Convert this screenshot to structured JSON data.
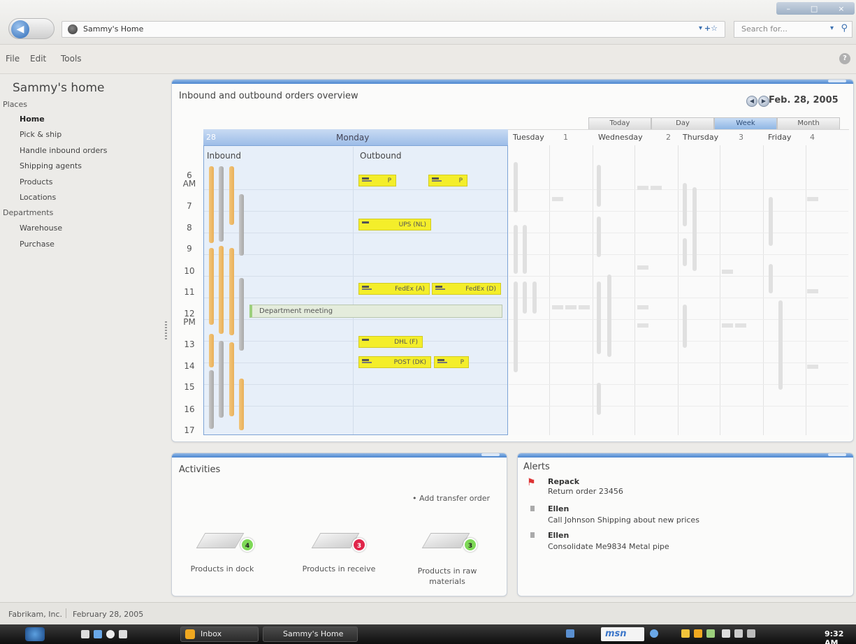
{
  "window": {
    "controls": [
      "–",
      "□",
      "×"
    ]
  },
  "address": {
    "page_title": "Sammy's Home",
    "dropdown": "▾",
    "favorites": "+☆",
    "search_placeholder": "Search for..."
  },
  "menu": {
    "items": [
      "File",
      "Edit",
      "Tools"
    ],
    "help": "?"
  },
  "sidebar": {
    "title": "Sammy's home",
    "places_label": "Places",
    "places": [
      "Home",
      "Pick & ship",
      "Handle inbound orders",
      "Shipping agents",
      "Products",
      "Locations"
    ],
    "departments_label": "Departments",
    "departments": [
      "Warehouse",
      "Purchase"
    ]
  },
  "calendar": {
    "title": "Inbound and outbound orders overview",
    "date": "Feb. 28, 2005",
    "prev": "◀",
    "next": "▶",
    "views": [
      "Today",
      "Day",
      "Week",
      "Month"
    ],
    "selected_view": "Week",
    "monday_num": "28",
    "monday_name": "Monday",
    "inbound_label": "Inbound",
    "outbound_label": "Outbound",
    "days": [
      {
        "name": "Tuesday",
        "num": "1"
      },
      {
        "name": "Wednesday",
        "num": "2"
      },
      {
        "name": "Thursday",
        "num": "3"
      },
      {
        "name": "Friday",
        "num": "4"
      }
    ],
    "hours": [
      {
        "h": "6",
        "ap": "AM"
      },
      {
        "h": "7",
        "ap": ""
      },
      {
        "h": "8",
        "ap": ""
      },
      {
        "h": "9",
        "ap": ""
      },
      {
        "h": "10",
        "ap": ""
      },
      {
        "h": "11",
        "ap": ""
      },
      {
        "h": "12",
        "ap": "PM"
      },
      {
        "h": "13",
        "ap": ""
      },
      {
        "h": "14",
        "ap": ""
      },
      {
        "h": "15",
        "ap": ""
      },
      {
        "h": "16",
        "ap": ""
      },
      {
        "h": "17",
        "ap": ""
      }
    ],
    "events": [
      "P",
      "P",
      "UPS (NL)",
      "FedEx (A)",
      "FedEx (D)",
      "DHL (F)",
      "POST (DK)",
      "P"
    ],
    "meeting": "Department meeting"
  },
  "activities": {
    "title": "Activities",
    "add_link": "• Add transfer order",
    "items": [
      {
        "label": "Products in dock",
        "count": "4",
        "color": "#7ed957"
      },
      {
        "label": "Products in receive",
        "count": "3",
        "color": "#e0264a"
      },
      {
        "label": "Products in raw materials",
        "count": "3",
        "color": "#7ed957"
      }
    ]
  },
  "alerts": {
    "title": "Alerts",
    "items": [
      {
        "name": "Repack",
        "text": "Return order 23456"
      },
      {
        "name": "Ellen",
        "text": "Call Johnson Shipping about new prices"
      },
      {
        "name": "Ellen",
        "text": "Consolidate Me9834 Metal pipe"
      }
    ]
  },
  "status": {
    "company": "Fabrikam, Inc.",
    "date": "February 28, 2005"
  },
  "taskbar": {
    "buttons": [
      "Inbox",
      "Sammy's Home"
    ],
    "msn": "msn",
    "time": "9:32 AM"
  }
}
